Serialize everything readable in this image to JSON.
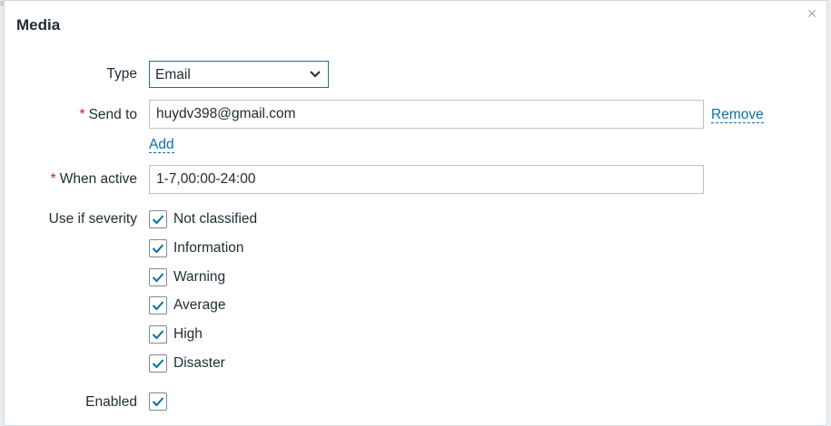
{
  "dialog": {
    "title": "Media",
    "close_glyph": "×"
  },
  "form": {
    "type": {
      "label": "Type",
      "selected": "Email"
    },
    "send_to": {
      "required_mark": "*",
      "label": "Send to",
      "value": "huydv398@gmail.com",
      "remove_label": "Remove",
      "add_label": "Add"
    },
    "when_active": {
      "required_mark": "*",
      "label": "When active",
      "value": "1-7,00:00-24:00"
    },
    "severity": {
      "label": "Use if severity",
      "options": [
        {
          "label": "Not classified",
          "checked": true
        },
        {
          "label": "Information",
          "checked": true
        },
        {
          "label": "Warning",
          "checked": true
        },
        {
          "label": "Average",
          "checked": true
        },
        {
          "label": "High",
          "checked": true
        },
        {
          "label": "Disaster",
          "checked": true
        }
      ]
    },
    "enabled": {
      "label": "Enabled",
      "checked": true
    }
  },
  "icons": {
    "close": "close-icon",
    "chevron": "chevron-down-icon",
    "check": "checkmark-icon"
  },
  "colors": {
    "accent": "#0b6fa7",
    "required": "#d21d1d",
    "select_border": "#1f6f8b"
  }
}
